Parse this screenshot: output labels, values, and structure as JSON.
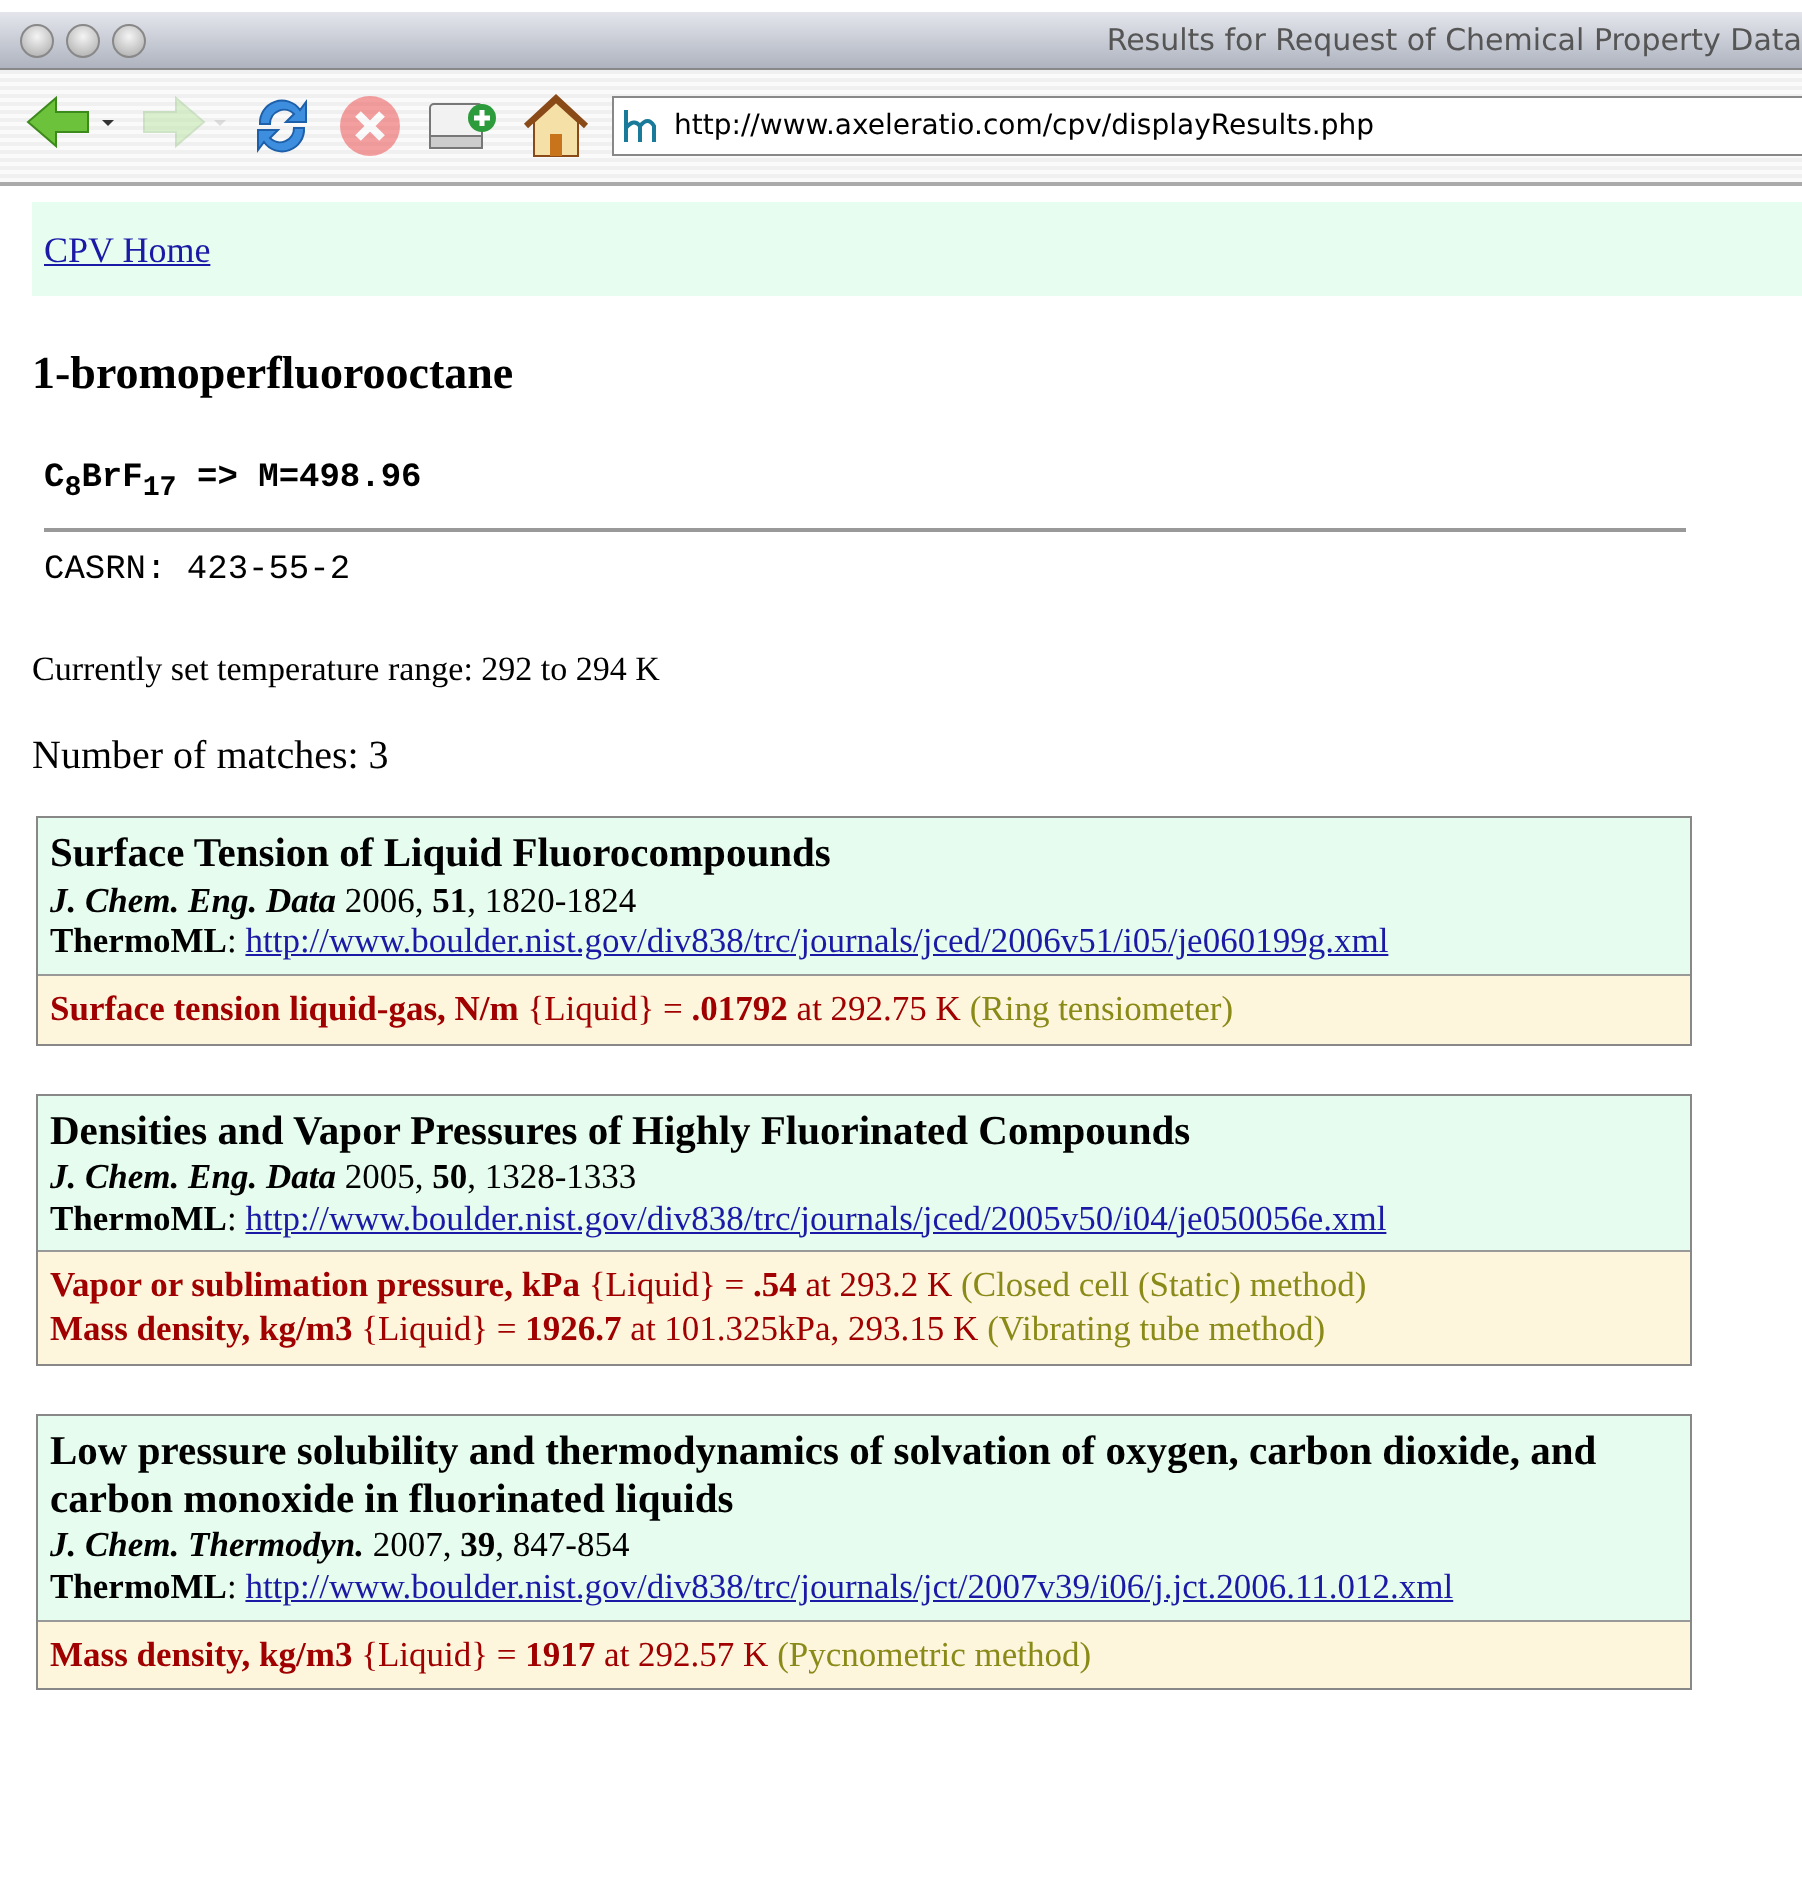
{
  "window": {
    "title": "Results for Request of Chemical Property Data"
  },
  "toolbar": {
    "back": {
      "disabled": false
    },
    "forward": {
      "disabled": true
    },
    "stop": {
      "disabled": true
    },
    "address": "http://www.axeleratio.com/cpv/displayResults.php"
  },
  "nav": {
    "link": "CPV Home"
  },
  "compound": {
    "name": "1-bromoperfluorooctane",
    "formula": "C$_{8}$BrF$_{17}$ => M=498.96",
    "casrn": "CASRN: 423-55-2"
  },
  "temperature_range": "Currently set temperature range: 292 to 294 K",
  "match_count": "Number of matches: 3",
  "results": [
    {
      "title": "Surface Tension of Liquid Fluorocompounds",
      "journal": {
        "name": "J. Chem. Eng. Data",
        "year": "2006,",
        "volume": "51",
        "pages": ", 1820-1824"
      },
      "thermoml_label": "**ThermoML**:",
      "url": "http://www.boulder.nist.gov/div838/trc/journals/jced/2006v51/i05/je060199g.xml",
      "properties": [
        {
          "text": "**Surface tension liquid-gas, N/m** {Liquid} = **.01792** at 292.75 K",
          "method": "(Ring tensiometer)"
        }
      ]
    },
    {
      "title": "Densities and Vapor Pressures of Highly Fluorinated Compounds",
      "journal": {
        "name": "J. Chem. Eng. Data",
        "year": "2005,",
        "volume": "50",
        "pages": ", 1328-1333"
      },
      "thermoml_label": "**ThermoML**:",
      "url": "http://www.boulder.nist.gov/div838/trc/journals/jced/2005v50/i04/je050056e.xml",
      "properties": [
        {
          "text": "**Vapor or sublimation pressure, kPa** {Liquid} = **.54** at 293.2 K",
          "method": "(Closed cell (Static) method)"
        },
        {
          "text": "**Mass density, kg/m3** {Liquid} = **1926.7** at 101.325kPa, 293.15 K",
          "method": "(Vibrating tube method)"
        }
      ]
    },
    {
      "title": "Low pressure solubility and thermodynamics of solvation of oxygen, carbon dioxide, and carbon monoxide in fluorinated liquids",
      "journal": {
        "name": "J. Chem. Thermodyn.",
        "year": "2007,",
        "volume": "39",
        "pages": ", 847-854"
      },
      "thermoml_label": "**ThermoML**:",
      "url": "http://www.boulder.nist.gov/div838/trc/journals/jct/2007v39/i06/j.jct.2006.11.012.xml",
      "properties": [
        {
          "text": "**Mass density, kg/m3** {Liquid} = **1917** at 292.57 K",
          "method": "(Pycnometric method)"
        }
      ]
    }
  ]
}
